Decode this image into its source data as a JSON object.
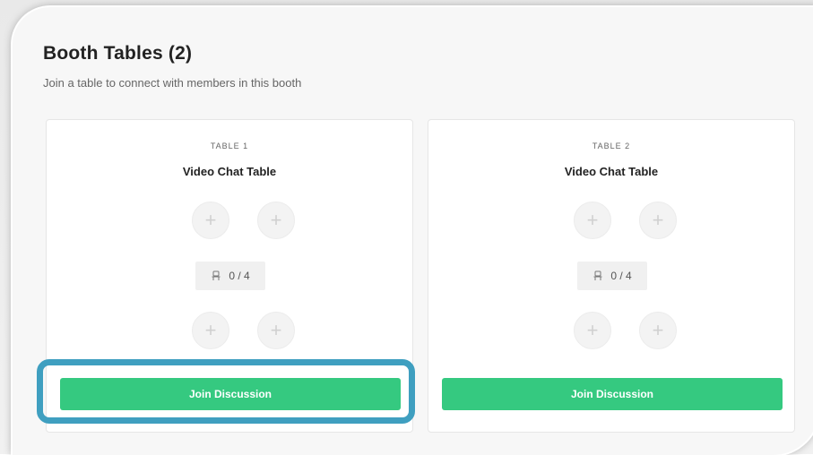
{
  "page": {
    "title": "Booth Tables (2)",
    "subtitle": "Join a table to connect with members in this booth"
  },
  "tables": [
    {
      "number_label": "TABLE 1",
      "name": "Video Chat Table",
      "seats_label": "0 / 4",
      "join_label": "Join Discussion",
      "seat_icon": "plus-icon"
    },
    {
      "number_label": "TABLE 2",
      "name": "Video Chat Table",
      "seats_label": "0 / 4",
      "join_label": "Join Discussion",
      "seat_icon": "plus-icon"
    }
  ],
  "colors": {
    "accent_green": "#35c980",
    "highlight_blue": "#3f9fc0"
  }
}
